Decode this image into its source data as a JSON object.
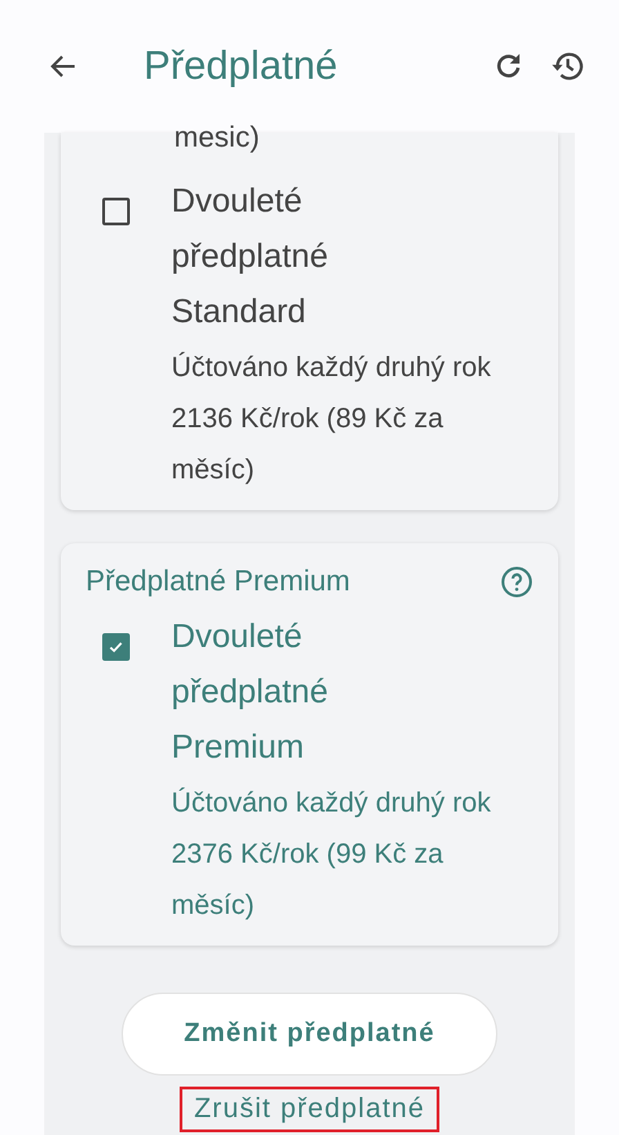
{
  "header": {
    "title": "Předplatné"
  },
  "cards": [
    {
      "leading_text": "mesic)",
      "options": [
        {
          "title": "Dvouleté předplatné Standard",
          "description": "Účtováno každý druhý rok 2136 Kč/rok (89 Kč za měsíc)",
          "checked": false
        }
      ]
    },
    {
      "heading": "Předplatné Premium",
      "options": [
        {
          "title": "Dvouleté předplatné Premium",
          "description": "Účtováno každý druhý rok 2376 Kč/rok (99 Kč za měsíc)",
          "checked": true
        }
      ]
    }
  ],
  "primary_button": "Změnit předplatné",
  "cancel_link": "Zrušit předplatné"
}
